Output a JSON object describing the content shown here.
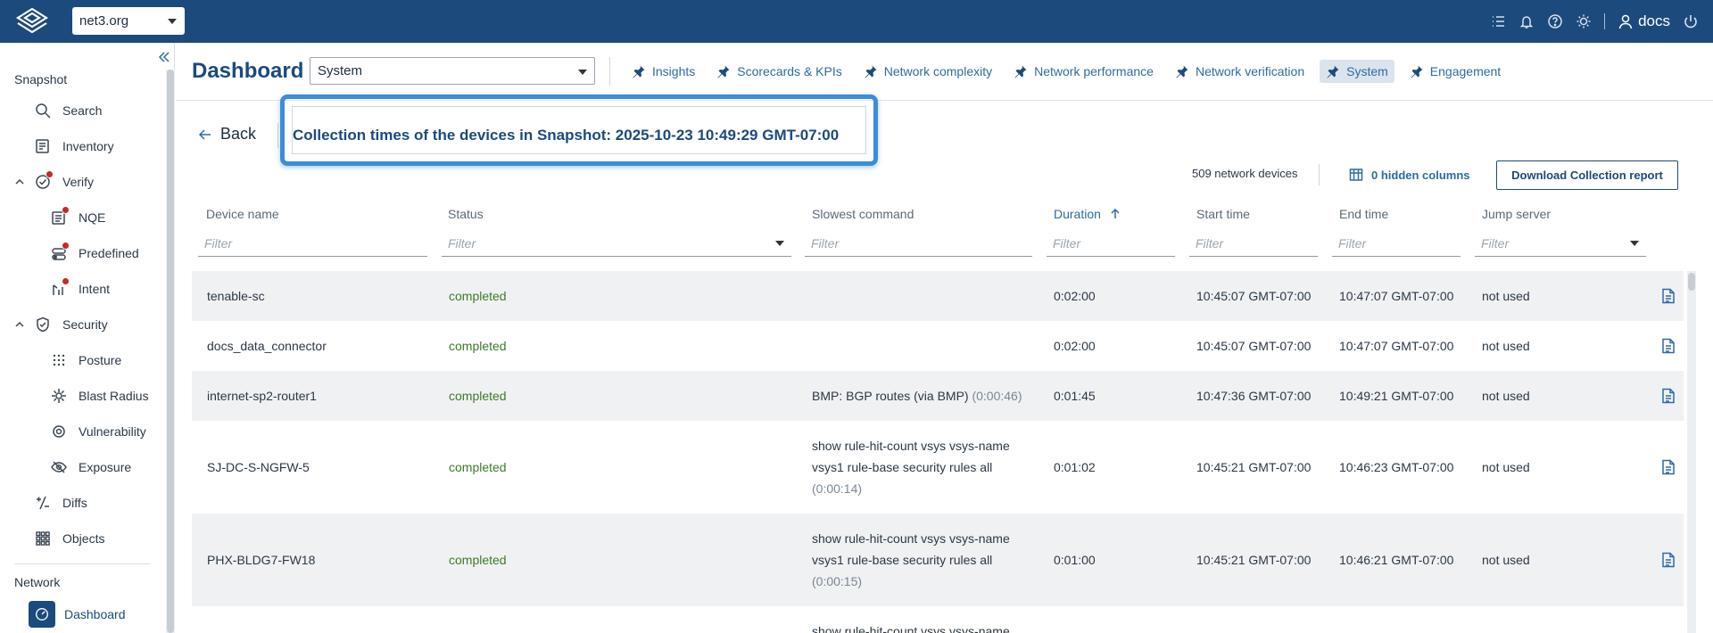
{
  "topbar": {
    "org": "net3.org",
    "user": "docs"
  },
  "sidebar": {
    "snapshot_title": "Snapshot",
    "items": [
      {
        "label": "Search"
      },
      {
        "label": "Inventory"
      },
      {
        "label": "Verify"
      },
      {
        "label": "NQE"
      },
      {
        "label": "Predefined"
      },
      {
        "label": "Intent"
      },
      {
        "label": "Security"
      },
      {
        "label": "Posture"
      },
      {
        "label": "Blast Radius"
      },
      {
        "label": "Vulnerability"
      },
      {
        "label": "Exposure"
      },
      {
        "label": "Diffs"
      },
      {
        "label": "Objects"
      }
    ],
    "network_title": "Network",
    "dashboard_label": "Dashboard"
  },
  "header": {
    "title": "Dashboard",
    "selected_dashboard": "System",
    "tabs": [
      {
        "label": "Insights"
      },
      {
        "label": "Scorecards & KPIs"
      },
      {
        "label": "Network complexity"
      },
      {
        "label": "Network performance"
      },
      {
        "label": "Network verification"
      },
      {
        "label": "System"
      },
      {
        "label": "Engagement"
      }
    ]
  },
  "page": {
    "back_label": "Back",
    "title": "Collection times of the devices in Snapshot: 2025-10-23  10:49:29 GMT-07:00",
    "device_count": "509 network devices",
    "hidden_columns": "0 hidden columns",
    "download_label": "Download Collection report"
  },
  "table": {
    "columns": [
      {
        "label": "Device name",
        "filter": "Filter"
      },
      {
        "label": "Status",
        "filter": "Filter"
      },
      {
        "label": "Slowest command",
        "filter": "Filter"
      },
      {
        "label": "Duration",
        "filter": "Filter"
      },
      {
        "label": "Start time",
        "filter": "Filter"
      },
      {
        "label": "End time",
        "filter": "Filter"
      },
      {
        "label": "Jump server",
        "filter": "Filter"
      }
    ],
    "rows": [
      {
        "device": "tenable-sc",
        "status": "completed",
        "cmd": "",
        "cmd_dur": "",
        "duration": "0:02:00",
        "start": "10:45:07 GMT-07:00",
        "end": "10:47:07 GMT-07:00",
        "jump": "not used"
      },
      {
        "device": "docs_data_connector",
        "status": "completed",
        "cmd": "",
        "cmd_dur": "",
        "duration": "0:02:00",
        "start": "10:45:07 GMT-07:00",
        "end": "10:47:07 GMT-07:00",
        "jump": "not used"
      },
      {
        "device": "internet-sp2-router1",
        "status": "completed",
        "cmd": "BMP: BGP routes (via BMP) ",
        "cmd_dur": "(0:00:46)",
        "duration": "0:01:45",
        "start": "10:47:36 GMT-07:00",
        "end": "10:49:21 GMT-07:00",
        "jump": "not used"
      },
      {
        "device": "SJ-DC-S-NGFW-5",
        "status": "completed",
        "cmd": "show rule-hit-count vsys vsys-name vsys1 rule-base security rules all ",
        "cmd_dur": "(0:00:14)",
        "duration": "0:01:02",
        "start": "10:45:21 GMT-07:00",
        "end": "10:46:23 GMT-07:00",
        "jump": "not used"
      },
      {
        "device": "PHX-BLDG7-FW18",
        "status": "completed",
        "cmd": "show rule-hit-count vsys vsys-name vsys1 rule-base security rules all ",
        "cmd_dur": "(0:00:15)",
        "duration": "0:01:00",
        "start": "10:45:21 GMT-07:00",
        "end": "10:46:21 GMT-07:00",
        "jump": "not used"
      },
      {
        "device": "",
        "status": "",
        "cmd": "show rule-hit-count vsys vsys-name",
        "cmd_dur": "",
        "duration": "",
        "start": "",
        "end": "",
        "jump": ""
      }
    ]
  },
  "colors": {
    "topbar": "#1c4a7c",
    "accent": "#2f6aa3",
    "status_completed": "#3d7a27",
    "highlight": "#3a8ddb"
  }
}
